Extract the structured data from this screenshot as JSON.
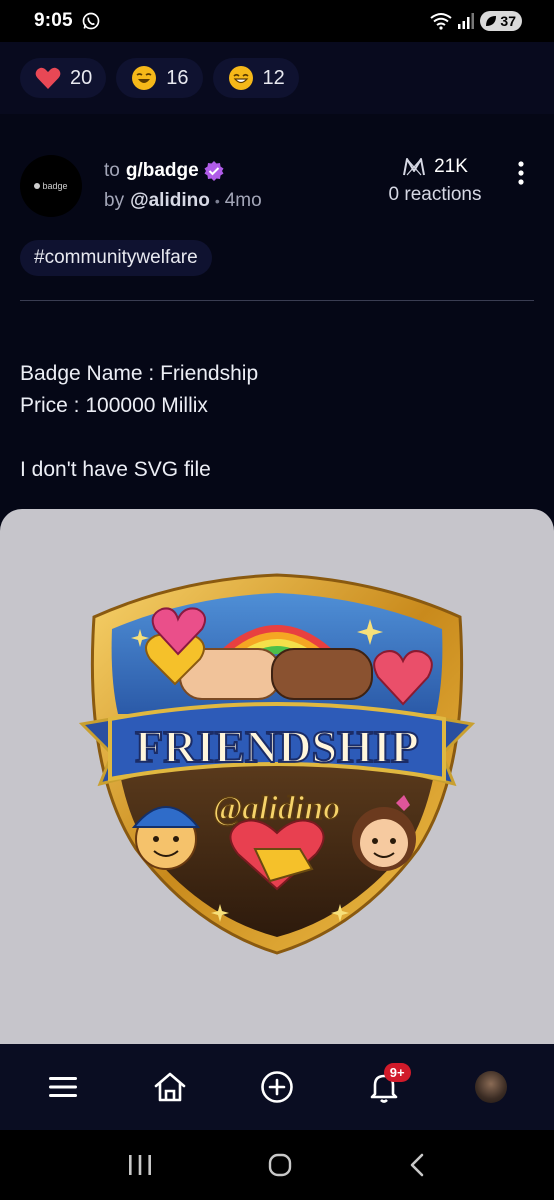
{
  "status_bar": {
    "time": "9:05",
    "battery": "37"
  },
  "reactions": [
    {
      "emoji": "heart",
      "count": "20"
    },
    {
      "emoji": "laughing-face",
      "count": "16"
    },
    {
      "emoji": "grinning-face",
      "count": "12"
    }
  ],
  "post": {
    "to_label": "to",
    "group": "g/badge",
    "by_label": "by",
    "author": "@alidino",
    "separator": "•",
    "age": "4mo",
    "avatar_text": "badge",
    "views": "21K",
    "reactions": "0 reactions",
    "tag": "#communitywelfare",
    "body": {
      "line1": "Badge Name : Friendship",
      "line2": "Price : 100000 Millix",
      "line3": "I don't have SVG file"
    },
    "image": {
      "title": "FRIENDSHIP",
      "handle": "@alidino"
    }
  },
  "bottom_nav": {
    "notifications_badge": "9+"
  },
  "colors": {
    "background": "#050716",
    "chip": "#0f1230",
    "verified": "#b05ce8",
    "notification": "#d11a2a"
  },
  "icons": [
    "whatsapp-icon",
    "wifi-icon",
    "signal-icon",
    "battery-icon",
    "heart-icon",
    "laughing-face-icon",
    "grinning-face-icon",
    "verified-icon",
    "views-icon",
    "more-icon",
    "menu-icon",
    "home-icon",
    "add-icon",
    "bell-icon",
    "recents-icon",
    "home-circle-icon",
    "back-icon"
  ]
}
